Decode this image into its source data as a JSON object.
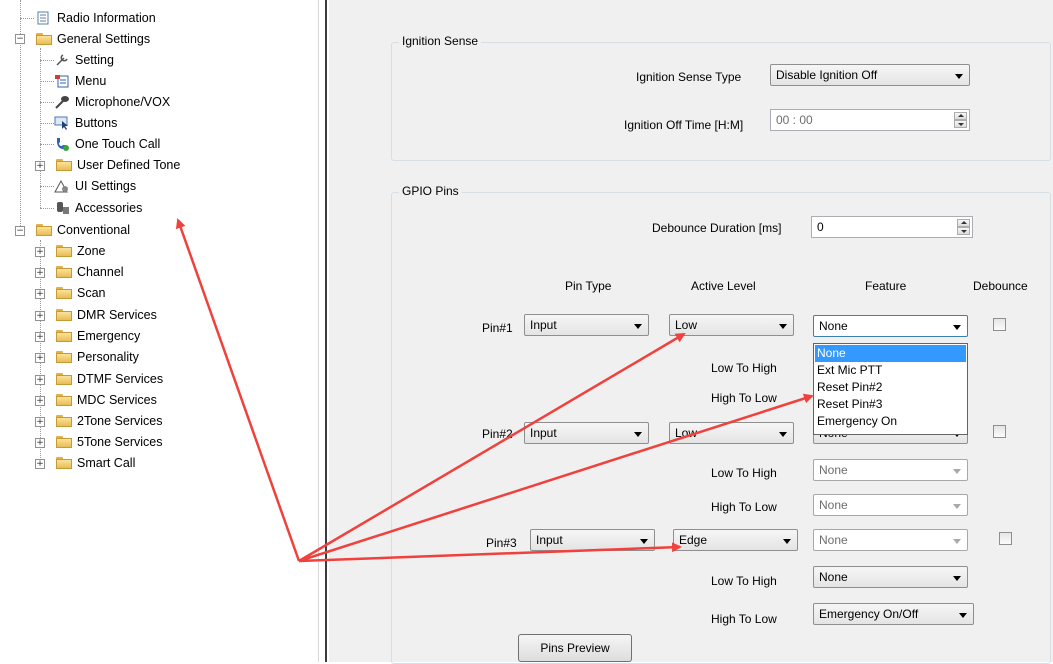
{
  "tree": {
    "radio_information": "Radio Information",
    "general_settings": "General Settings",
    "setting": "Setting",
    "menu": "Menu",
    "microphone_vox": "Microphone/VOX",
    "buttons": "Buttons",
    "one_touch_call": "One Touch Call",
    "user_defined_tone": "User Defined Tone",
    "ui_settings": "UI Settings",
    "accessories": "Accessories",
    "conventional": "Conventional",
    "zone": "Zone",
    "channel": "Channel",
    "scan": "Scan",
    "dmr_services": "DMR Services",
    "emergency": "Emergency",
    "personality": "Personality",
    "dtmf_services": "DTMF Services",
    "mdc_services": "MDC Services",
    "two_tone_services": "2Tone Services",
    "five_tone_services": "5Tone Services",
    "smart_call": "Smart Call"
  },
  "ignition": {
    "title": "Ignition Sense",
    "type_label": "Ignition Sense Type",
    "type_value": "Disable Ignition Off",
    "off_time_label": "Ignition Off Time [H:M]",
    "off_time_value": "00 : 00"
  },
  "gpio": {
    "title": "GPIO Pins",
    "debounce_duration_label": "Debounce Duration [ms]",
    "debounce_duration_value": "0",
    "col_pin_type": "Pin Type",
    "col_active_level": "Active Level",
    "col_feature": "Feature",
    "col_debounce": "Debounce",
    "low_to_high": "Low To High",
    "high_to_low": "High To Low",
    "pins": [
      {
        "name": "Pin#1",
        "type": "Input",
        "level": "Low",
        "feature": "None"
      },
      {
        "name": "Pin#2",
        "type": "Input",
        "level": "Low",
        "feature": "None",
        "lth": "None",
        "htl": "None"
      },
      {
        "name": "Pin#3",
        "type": "Input",
        "level": "Edge",
        "feature": "None",
        "lth": "None",
        "htl": "Emergency On/Off"
      }
    ],
    "dropdown_options": [
      "None",
      "Ext Mic PTT",
      "Reset Pin#2",
      "Reset Pin#3",
      "Emergency On"
    ],
    "pins_preview": "Pins Preview"
  },
  "colors": {
    "arrow": "#f0413c",
    "selection": "#3399ff",
    "folder": "#f5d27a"
  }
}
